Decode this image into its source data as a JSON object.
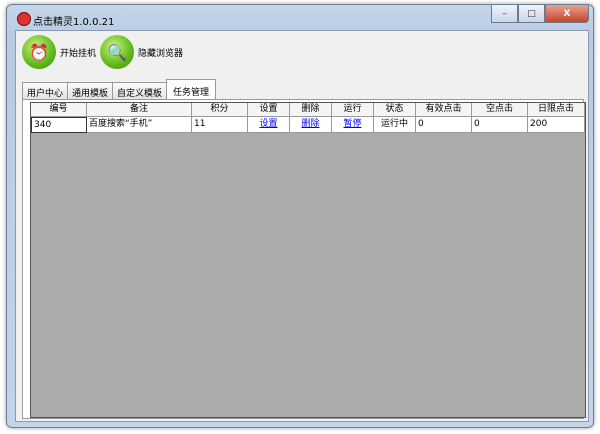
{
  "window": {
    "title": "点击精灵1.0.0.21",
    "minimize": "–",
    "maximize": "□",
    "close": "X"
  },
  "toolbar": {
    "start": "开始挂机",
    "hide_browser": "隐藏浏览器"
  },
  "tabs": [
    {
      "label": "用户中心"
    },
    {
      "label": "通用模板"
    },
    {
      "label": "自定义模板"
    },
    {
      "label": "任务管理",
      "active": true
    }
  ],
  "table": {
    "columns": [
      "编号",
      "备注",
      "积分",
      "设置",
      "删除",
      "运行",
      "状态",
      "有效点击",
      "空点击",
      "日限点击"
    ],
    "rows": [
      {
        "id": "340",
        "note": "百度搜索“手机”",
        "points": "11",
        "settings": "设置",
        "delete": "删除",
        "run": "暂停",
        "status": "运行中",
        "valid_clicks": "0",
        "empty_clicks": "0",
        "daily_limit": "200"
      }
    ]
  }
}
